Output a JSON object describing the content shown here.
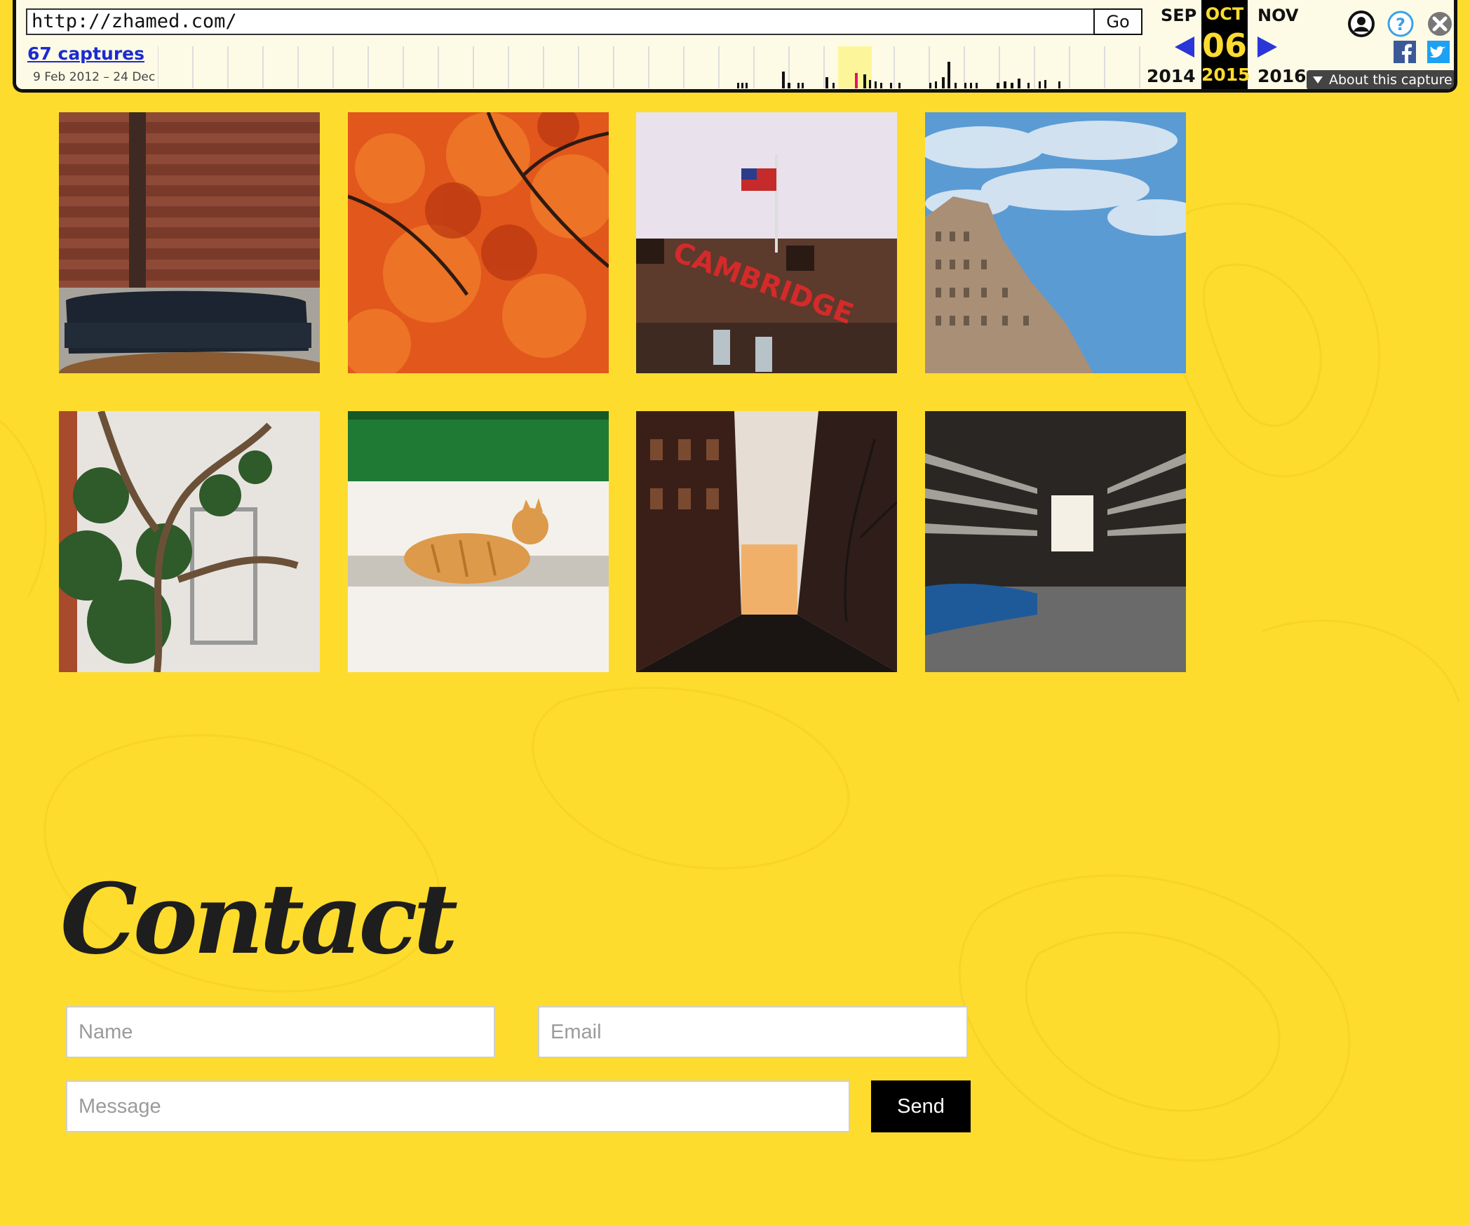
{
  "wayback": {
    "url": "http://zhamed.com/",
    "go_label": "Go",
    "captures_link": "67 captures",
    "date_range": "9 Feb 2012 – 24 Dec",
    "prev_month": "SEP",
    "current_month": "OCT",
    "next_month": "NOV",
    "current_day": "06",
    "prev_year": "2014",
    "current_year": "2015",
    "next_year": "2016",
    "about_label": "About this capture"
  },
  "gallery": {
    "photos": [
      {
        "subject": "leather sofa against brick wall"
      },
      {
        "subject": "red autumn maple leaves"
      },
      {
        "subject": "Cambridge Savings Bank sign with flag"
      },
      {
        "subject": "ornate building against cloudy sky"
      },
      {
        "subject": "ivy covered tree by window"
      },
      {
        "subject": "orange cat by green door"
      },
      {
        "subject": "city street at sunset"
      },
      {
        "subject": "boathouse with rowing shells"
      }
    ]
  },
  "contact": {
    "title": "Contact",
    "name_placeholder": "Name",
    "email_placeholder": "Email",
    "message_placeholder": "Message",
    "send_label": "Send"
  },
  "colors": {
    "background": "#fedc2e",
    "toolbar_bg": "#fdfbe6",
    "highlight": "#fedc2e",
    "link": "#1b2bd0",
    "send_bg": "#000000"
  }
}
